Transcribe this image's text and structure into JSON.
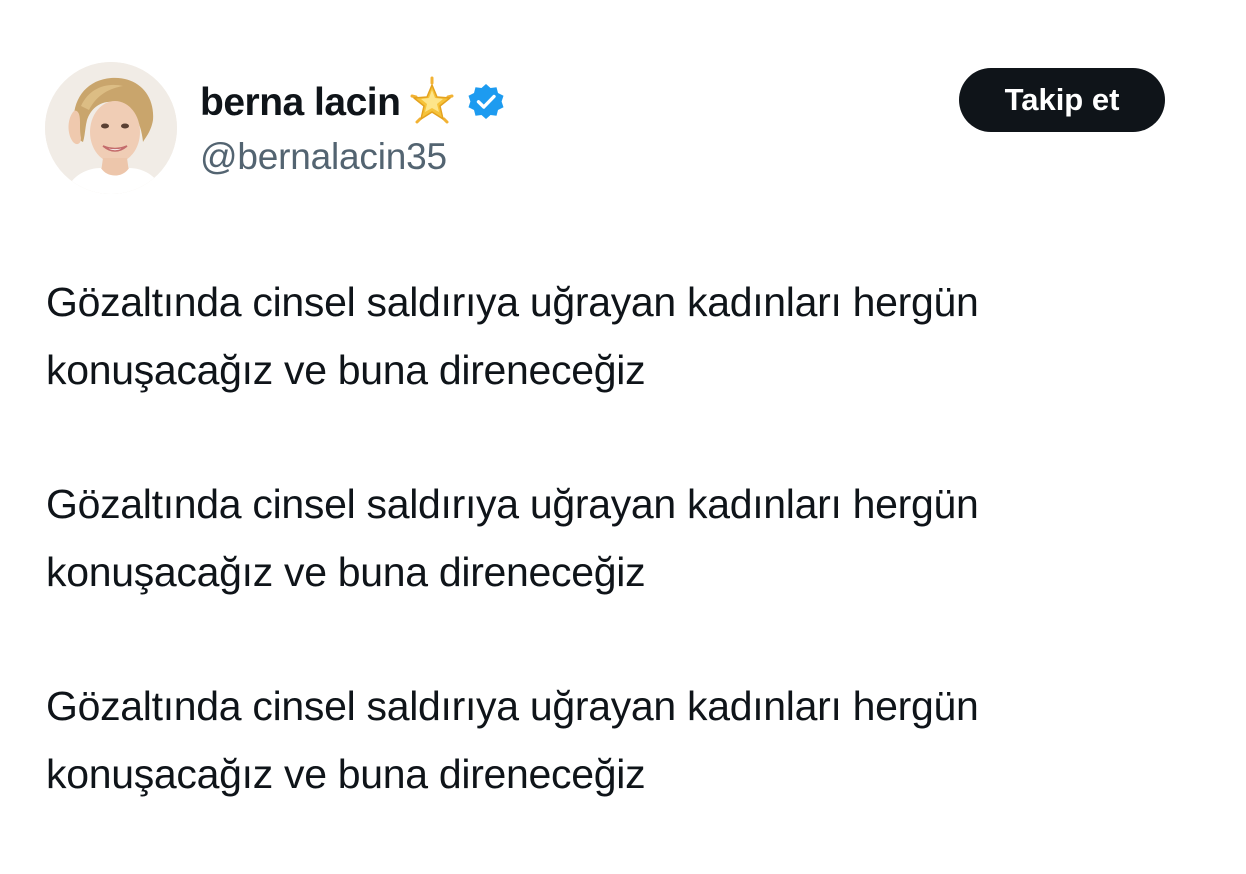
{
  "author": {
    "display_name": "berna lacin",
    "handle": "@bernalacin35",
    "name_emoji": "glowing-star-icon",
    "verified_badge": "verified-badge-icon"
  },
  "actions": {
    "follow_label": "Takip et"
  },
  "tweet": {
    "paragraphs": [
      {
        "line1": "Gözaltında cinsel saldırıya uğrayan kadınları hergün",
        "line2": "konuşacağız ve buna direneceğiz"
      },
      {
        "line1": "Gözaltında cinsel saldırıya uğrayan kadınları hergün",
        "line2": "konuşacağız ve buna direneceğiz"
      },
      {
        "line1": "Gözaltında cinsel saldırıya uğrayan kadınları hergün",
        "line2": "konuşacağız ve buna direneceğiz"
      }
    ]
  },
  "colors": {
    "text_primary": "#0f1419",
    "text_secondary": "#536471",
    "verified_blue": "#1d9bf0",
    "button_bg": "#0f1419",
    "button_text": "#ffffff",
    "star_gold": "#f6c33a"
  }
}
